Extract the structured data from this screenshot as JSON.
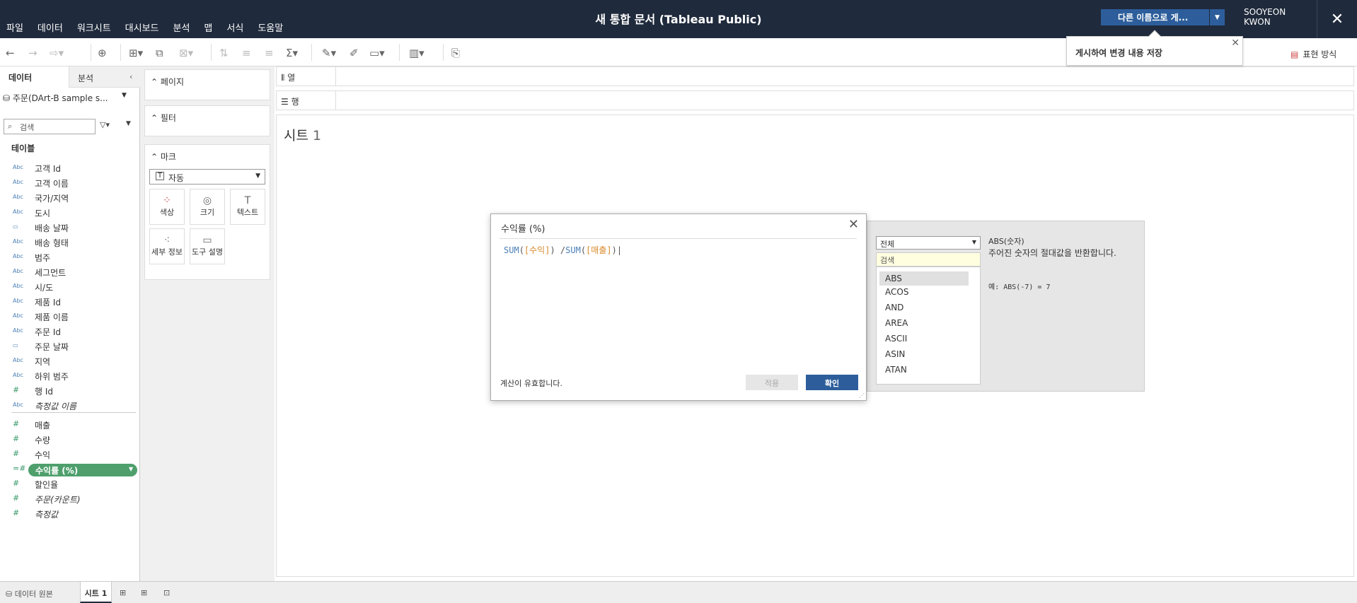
{
  "menu": [
    "파일",
    "데이터",
    "워크시트",
    "대시보드",
    "분석",
    "맵",
    "서식",
    "도움말"
  ],
  "title": "새 통합 문서 (Tableau Public)",
  "save_button": "다른 이름으로 게...",
  "user": {
    "line1": "SOOYEON",
    "line2": "KWON"
  },
  "tooltip": "게시하여 변경 내용 저장",
  "show_me": "표현 방식",
  "data_pane": {
    "tab_data": "데이터",
    "tab_analysis": "분석",
    "datasource": "주문(DArt-B sample s...",
    "search_placeholder": "검색",
    "tables_header": "테이블",
    "dimensions": [
      {
        "type": "Abc",
        "name": "고객 Id"
      },
      {
        "type": "Abc",
        "name": "고객 이름"
      },
      {
        "type": "Abc",
        "name": "국가/지역"
      },
      {
        "type": "Abc",
        "name": "도시"
      },
      {
        "type": "date",
        "name": "배송 날짜"
      },
      {
        "type": "Abc",
        "name": "배송 형태"
      },
      {
        "type": "Abc",
        "name": "범주"
      },
      {
        "type": "Abc",
        "name": "세그먼트"
      },
      {
        "type": "Abc",
        "name": "시/도"
      },
      {
        "type": "Abc",
        "name": "제품 Id"
      },
      {
        "type": "Abc",
        "name": "제품 이름"
      },
      {
        "type": "Abc",
        "name": "주문 Id"
      },
      {
        "type": "date",
        "name": "주문 날짜"
      },
      {
        "type": "Abc",
        "name": "지역"
      },
      {
        "type": "Abc",
        "name": "하위 범주"
      },
      {
        "type": "#",
        "name": "행 Id"
      },
      {
        "type": "Abc",
        "name": "측정값 이름"
      }
    ],
    "measures": [
      {
        "type": "#",
        "name": "매출"
      },
      {
        "type": "#",
        "name": "수량"
      },
      {
        "type": "#",
        "name": "수익"
      },
      {
        "type": "=#",
        "name": "수익률 (%)"
      },
      {
        "type": "#",
        "name": "할인율"
      },
      {
        "type": "#",
        "name": "주문(카운트)"
      },
      {
        "type": "#",
        "name": "측정값"
      }
    ]
  },
  "cards": {
    "pages": "페이지",
    "filters": "필터",
    "marks": "마크",
    "mark_type": "자동",
    "mark_buttons": [
      "색상",
      "크기",
      "텍스트",
      "세부 정보",
      "도구 설명"
    ]
  },
  "shelves": {
    "columns": "열",
    "rows": "행"
  },
  "sheet_title": {
    "text": "시트",
    "num": "1"
  },
  "dialog": {
    "title": "수익률 (%)",
    "formula": {
      "fn1": "SUM",
      "f1": "[수익]",
      "op": "/",
      "fn2": "SUM",
      "f2": "[매출]"
    },
    "status": "계산이 유효합니다.",
    "apply": "적용",
    "ok": "확인"
  },
  "functions": {
    "category": "전체",
    "search": "검색",
    "items": [
      "ABS",
      "ACOS",
      "AND",
      "AREA",
      "ASCII",
      "ASIN",
      "ATAN"
    ],
    "signature": "ABS(숫자)",
    "description": "주어진 숫자의 절대값을 반환합니다.",
    "example": "예: ABS(-7) = 7"
  },
  "bottom": {
    "datasource_tab": "데이터 원본",
    "sheet_tab": "시트 1"
  }
}
